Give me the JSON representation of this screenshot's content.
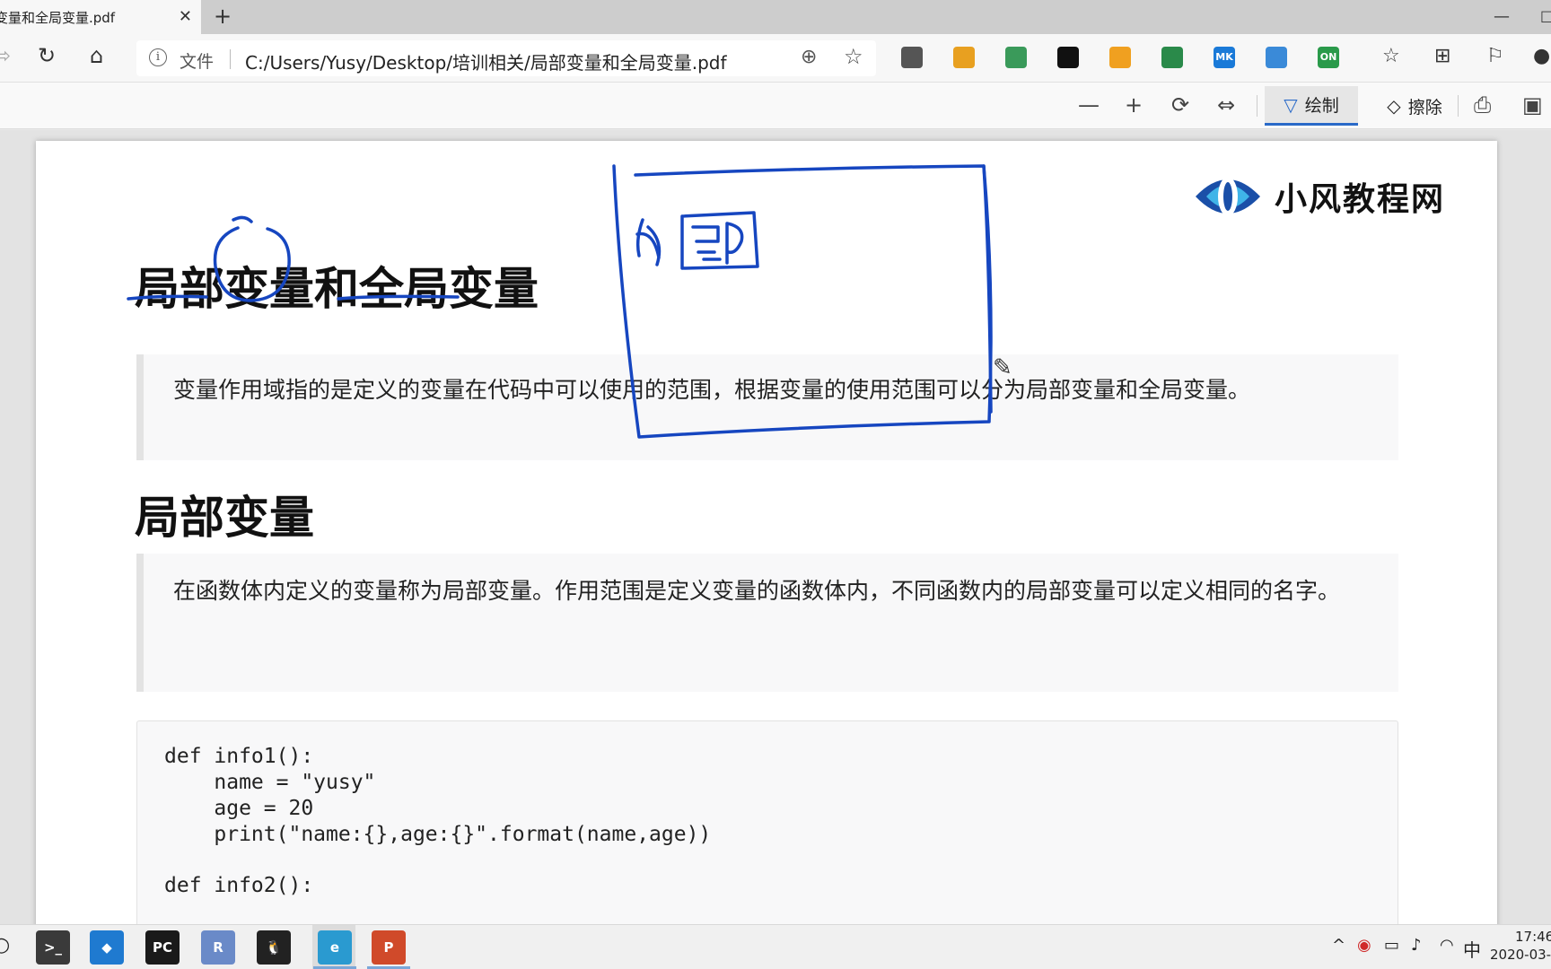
{
  "browser": {
    "tab_title": "变量和全局变量.pdf",
    "tab_close": "✕",
    "new_tab": "+",
    "window_min": "—",
    "window_max": "□",
    "address": {
      "info": "i",
      "file_label": "文件",
      "url": "C:/Users/Yusy/Desktop/培训相关/局部变量和全局变量.pdf"
    },
    "extensions": [
      {
        "icon": "extension-icon",
        "color": "#555555",
        "text": ""
      },
      {
        "icon": "microscope-icon",
        "color": "#e8a020",
        "text": ""
      },
      {
        "icon": "magnifier-icon",
        "color": "#3a9a5a",
        "text": ""
      },
      {
        "icon": "lock-icon",
        "color": "#111111",
        "text": ""
      },
      {
        "icon": "orange-icon",
        "color": "#f0a020",
        "text": ""
      },
      {
        "icon": "bookmark-icon",
        "color": "#2a8a4a",
        "text": ""
      },
      {
        "icon": "mk-icon",
        "color": "#1a7ad8",
        "text": "MK"
      },
      {
        "icon": "shield-icon",
        "color": "#3a8ad8",
        "text": ""
      },
      {
        "icon": "on-icon",
        "color": "#2a9a4a",
        "text": "ON"
      }
    ]
  },
  "pdf_toolbar": {
    "zoom_out": "—",
    "zoom_in": "+",
    "draw_label": "绘制",
    "erase_label": "擦除"
  },
  "document": {
    "logo_text": "小风教程网",
    "heading1": "局部变量和全局变量",
    "para1": "变量作用域指的是定义的变量在代码中可以使用的范围，根据变量的使用范围可以分为局部变量和全局变量。",
    "heading2": "局部变量",
    "para2": "在函数体内定义的变量称为局部变量。作用范围是定义变量的函数体内，不同函数内的局部变量可以定义相同的名字。",
    "code_lines": [
      "def info1():",
      "    name = \"yusy\"",
      "    age = 20",
      "    print(\"name:{},age:{}\".format(name,age))",
      "",
      "def info2():"
    ]
  },
  "taskbar": {
    "apps": [
      {
        "name": "terminal",
        "color": "#3a3a3a",
        "text": ">_"
      },
      {
        "name": "vscode",
        "color": "#1f7ad0",
        "text": "◆"
      },
      {
        "name": "pycharm",
        "color": "#1a1a1a",
        "text": "PC"
      },
      {
        "name": "r-app",
        "color": "#6a8ac8",
        "text": "R"
      },
      {
        "name": "qq",
        "color": "#222222",
        "text": "🐧"
      },
      {
        "name": "edge-beta",
        "color": "#2a9ad0",
        "text": "e"
      },
      {
        "name": "powerpoint",
        "color": "#d04a2a",
        "text": "P"
      }
    ],
    "tray_caret": "^",
    "ime": "中",
    "time": "17:46",
    "date": "2020-03-"
  }
}
